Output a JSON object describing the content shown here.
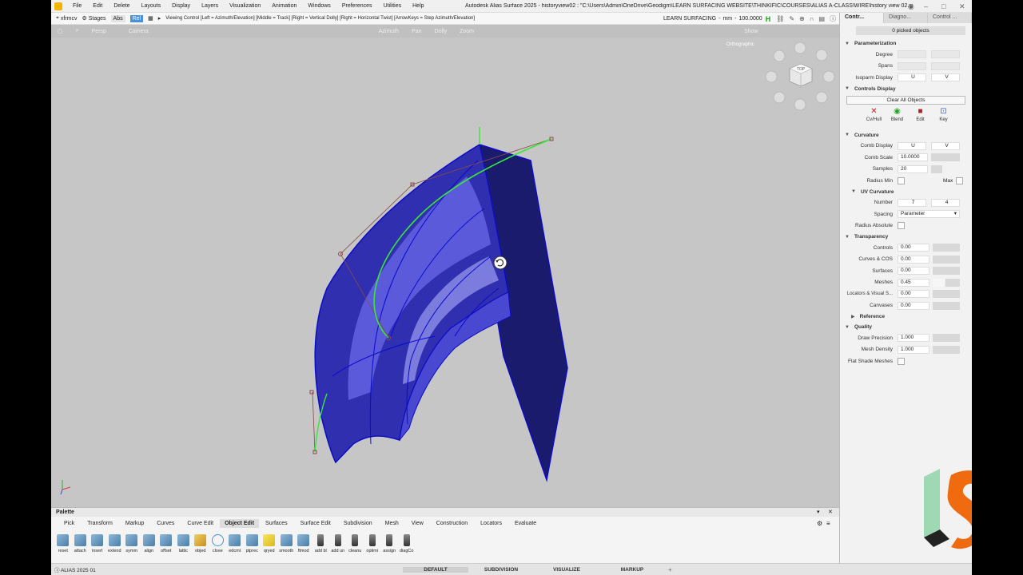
{
  "menubar": {
    "items": [
      "File",
      "Edit",
      "Delete",
      "Layouts",
      "Display",
      "Layers",
      "Visualization",
      "Animation",
      "Windows",
      "Preferences",
      "Utilities",
      "Help"
    ],
    "window_title": "Autodesk Alias Surface 2025  -  historyview02 : \"C:\\Users\\Admin\\OneDrive\\Geodigm\\LEARN SURFACING WEBSITE\\THINKIFIC\\COURSES\\ALIAS A-CLASS\\WIRE\\history view 02.wire\""
  },
  "toolbar": {
    "tool_name": "xfrmcv",
    "stages": "Stages",
    "abs": "Abs",
    "rel": "Rel",
    "hint": "Viewing Control  [Left = Azimuth/Elevation]  [Middle = Track]  [Right = Vertical Dolly]  [Right = Horizontal Twist]  [ArrowKeys = Step Azimuth/Elevation]",
    "project": "LEARN SURFACING",
    "units": "mm",
    "value": "100.0000",
    "h_label": "H"
  },
  "viewport": {
    "view_name": "Persp",
    "camera": "Camera",
    "azimuth": "Azimuth",
    "pan": "Pan",
    "dolly": "Dolly",
    "zoom": "Zoom",
    "show": "Show",
    "ortho": "Orthographic",
    "cube_label": "TOP"
  },
  "panel": {
    "tabs": [
      "Contr...",
      "Diagno...",
      "Control ..."
    ],
    "picked": "0 picked objects",
    "parameterization": {
      "title": "Parameterization",
      "degree": "Degree",
      "spans": "Spans",
      "isoparm": "Isoparm Display",
      "u": "U",
      "v": "V"
    },
    "controls_display": {
      "title": "Controls Display",
      "clear": "Clear All Objects",
      "icons": [
        "Cv/Hull",
        "Blend",
        "Edit",
        "Key"
      ]
    },
    "curvature": {
      "title": "Curvature",
      "comb_display": "Comb Display",
      "u": "U",
      "v": "V",
      "comb_scale": "Comb Scale",
      "comb_scale_val": "10.0000",
      "samples": "Samples",
      "samples_val": "20",
      "radius_min": "Radius Min",
      "max": "Max"
    },
    "uv_curvature": {
      "title": "UV Curvature",
      "number": "Number",
      "num_u": "7",
      "num_v": "4",
      "spacing": "Spacing",
      "spacing_val": "Parameter",
      "radius_abs": "Radius Absolute"
    },
    "transparency": {
      "title": "Transparency",
      "rows": [
        {
          "label": "Controls",
          "value": "0.00"
        },
        {
          "label": "Curves & COS",
          "value": "0.00"
        },
        {
          "label": "Surfaces",
          "value": "0.00"
        },
        {
          "label": "Meshes",
          "value": "0.45"
        },
        {
          "label": "Locators & Visual S...",
          "value": "0.00"
        },
        {
          "label": "Canvases",
          "value": "0.00"
        }
      ]
    },
    "reference": {
      "title": "Reference"
    },
    "quality": {
      "title": "Quality",
      "draw_precision": "Draw Precision",
      "draw_precision_val": "1.000",
      "mesh_density": "Mesh Density",
      "mesh_density_val": "1.000",
      "flat_shade": "Flat Shade Meshes"
    }
  },
  "palette": {
    "title": "Palette",
    "tabs": [
      "Pick",
      "Transform",
      "Markup",
      "Curves",
      "Curve Edit",
      "Object Edit",
      "Surfaces",
      "Surface Edit",
      "Subdivision",
      "Mesh",
      "View",
      "Construction",
      "Locators",
      "Evaluate"
    ],
    "active_tab": "Object Edit",
    "tools": [
      "reset",
      "attach",
      "insert",
      "extend",
      "symm",
      "align",
      "offset",
      "lattic",
      "objed",
      "close",
      "edcmt",
      "ptprec",
      "qryed",
      "smooth",
      "ftmod",
      "add bl",
      "add un",
      "cleanu",
      "optimi",
      "assign",
      "diagCo"
    ]
  },
  "statusbar": {
    "version": "ALIAS 2025 01",
    "tabs": [
      "DEFAULT",
      "SUBDIVISION",
      "VISUALIZE",
      "MARKUP"
    ],
    "add": "+"
  },
  "colors": {
    "surface": "#3d3dd6",
    "surface_dark": "#14146e",
    "curve": "#39e639",
    "hull": "#8a4a4a",
    "accent": "#4a90d9"
  }
}
